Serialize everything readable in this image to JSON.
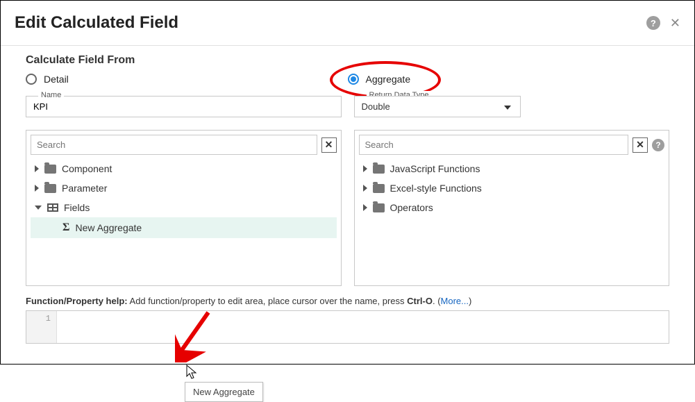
{
  "dialog": {
    "title": "Edit Calculated Field",
    "section_title": "Calculate Field From",
    "radio": {
      "detail": "Detail",
      "aggregate": "Aggregate"
    }
  },
  "fields": {
    "name_label": "Name",
    "name_value": "KPI",
    "return_type_label": "Return Data Type",
    "return_type_value": "Double"
  },
  "left_panel": {
    "search_placeholder": "Search",
    "items": {
      "component": "Component",
      "parameter": "Parameter",
      "fields": "Fields",
      "new_aggregate": "New Aggregate"
    }
  },
  "right_panel": {
    "search_placeholder": "Search",
    "items": {
      "js_functions": "JavaScript Functions",
      "excel_functions": "Excel-style Functions",
      "operators": "Operators"
    }
  },
  "tooltip_text": "New Aggregate",
  "help": {
    "prefix_bold": "Function/Property help:",
    "body": " Add function/property to edit area, place cursor over the name, press ",
    "key": "Ctrl-O",
    "suffix": ". (",
    "more": "More...",
    "close": ")"
  },
  "editor": {
    "line": "1"
  }
}
